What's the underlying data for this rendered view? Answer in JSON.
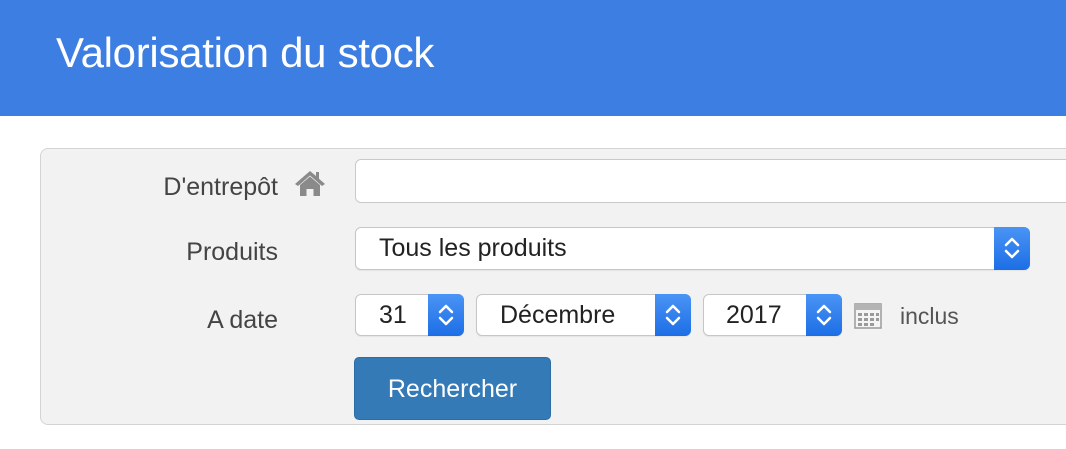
{
  "header": {
    "title": "Valorisation du stock"
  },
  "form": {
    "warehouse": {
      "label": "D'entrepôt",
      "icon": "home-icon",
      "value": ""
    },
    "products": {
      "label": "Produits",
      "selected": "Tous les produits"
    },
    "date": {
      "label": "A date",
      "day": "31",
      "month": "Décembre",
      "year": "2017",
      "calendar_icon": "calendar-icon",
      "inclusive_label": "inclus"
    },
    "search_button": "Rechercher"
  },
  "colors": {
    "header_bg": "#3d7ee3",
    "button_bg": "#337ab7",
    "spinner_bg": "#2a7cf0",
    "panel_bg": "#f2f2f2"
  }
}
